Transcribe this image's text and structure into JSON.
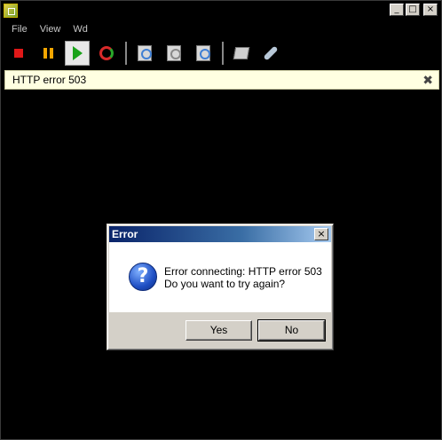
{
  "window": {
    "title": "",
    "buttons": {
      "minimize": "_",
      "maximize": "□",
      "close": "×"
    }
  },
  "menu": [
    "File",
    "View",
    "Wd"
  ],
  "toolbar": {
    "buttons": [
      {
        "name": "stop",
        "icon": "stop-icon",
        "color": "#e01818"
      },
      {
        "name": "pause",
        "icon": "pause-icon",
        "color": "#f5a600"
      },
      {
        "name": "play",
        "icon": "play-icon",
        "color": "#1aa31a",
        "active": true
      },
      {
        "name": "refresh",
        "icon": "refresh-icon"
      },
      {
        "name": "tool-1",
        "icon": "gear-doc-icon"
      },
      {
        "name": "tool-2",
        "icon": "gear-doc-icon"
      },
      {
        "name": "tool-3",
        "icon": "gear-doc-icon"
      },
      {
        "name": "edit",
        "icon": "edit-icon"
      },
      {
        "name": "wrench",
        "icon": "wrench-icon"
      }
    ]
  },
  "infobar": {
    "text": "HTTP error 503",
    "close": "✖"
  },
  "dialog": {
    "title": "Error",
    "close": "×",
    "icon": "question-icon",
    "icon_glyph": "?",
    "message_line1": "Error connecting: HTTP error 503",
    "message_line2": "Do you want to try again?",
    "yes_label": "Yes",
    "no_label": "No"
  }
}
